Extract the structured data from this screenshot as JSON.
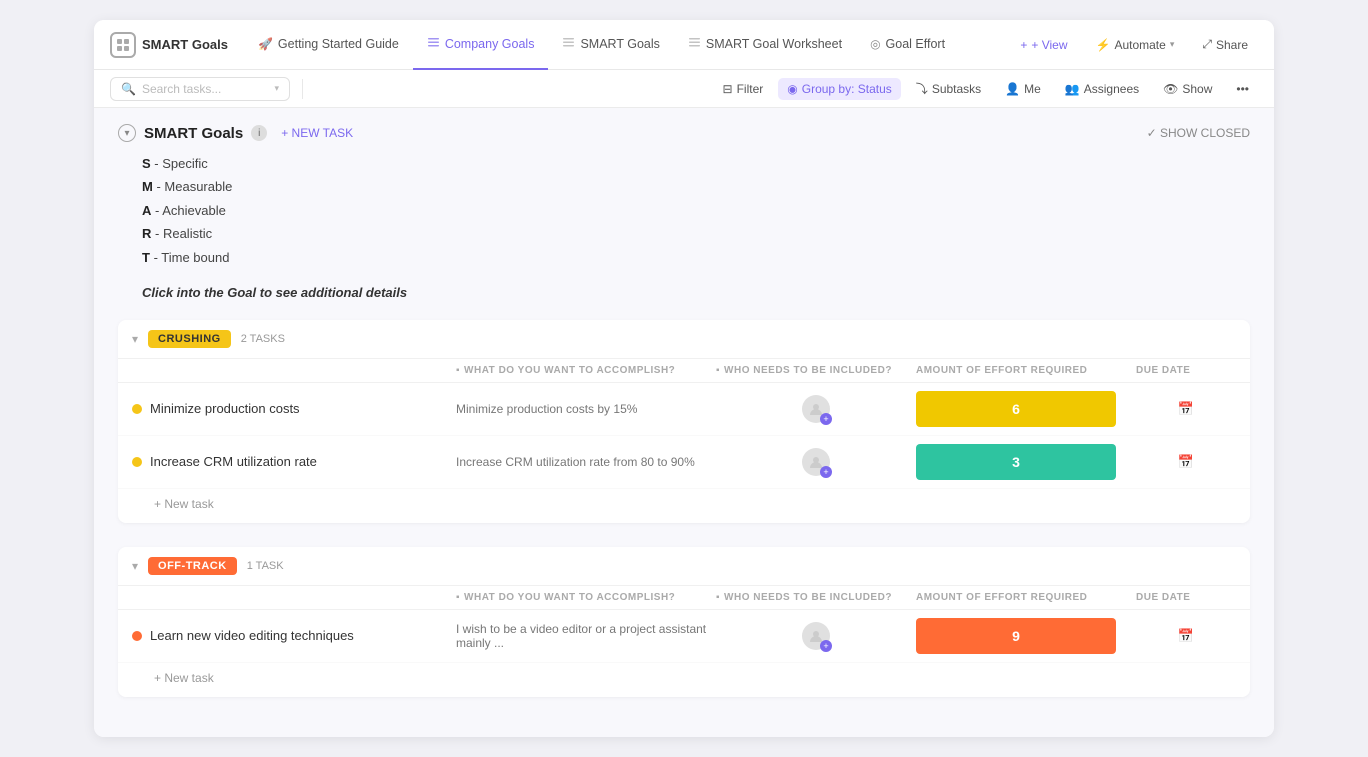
{
  "app": {
    "logo_label": "SMART Goals",
    "logo_icon": "⊞"
  },
  "tabs": [
    {
      "id": "getting-started",
      "label": "Getting Started Guide",
      "icon": "🚀",
      "active": false
    },
    {
      "id": "company-goals",
      "label": "Company Goals",
      "icon": "≡",
      "active": true
    },
    {
      "id": "smart-goals",
      "label": "SMART Goals",
      "icon": "≡",
      "active": false
    },
    {
      "id": "smart-worksheet",
      "label": "SMART Goal Worksheet",
      "icon": "≡",
      "active": false
    },
    {
      "id": "goal-effort",
      "label": "Goal Effort",
      "icon": "◎",
      "active": false
    }
  ],
  "toolbar_right": [
    {
      "id": "view",
      "label": "+ View",
      "icon": "+"
    },
    {
      "id": "automate",
      "label": "Automate",
      "icon": "⚡"
    },
    {
      "id": "share",
      "label": "Share",
      "icon": "⤢"
    }
  ],
  "search": {
    "placeholder": "Search tasks..."
  },
  "tools": [
    {
      "id": "filter",
      "label": "Filter",
      "icon": "⊟",
      "active": false
    },
    {
      "id": "group-by",
      "label": "Group by: Status",
      "icon": "◉",
      "active": true
    },
    {
      "id": "subtasks",
      "label": "Subtasks",
      "icon": "⤵",
      "active": false
    },
    {
      "id": "me",
      "label": "Me",
      "icon": "👤",
      "active": false
    },
    {
      "id": "assignees",
      "label": "Assignees",
      "icon": "👥",
      "active": false
    },
    {
      "id": "show",
      "label": "Show",
      "icon": "👁",
      "active": false
    }
  ],
  "section": {
    "title": "SMART Goals",
    "new_task_label": "+ NEW TASK",
    "show_closed_label": "✓ SHOW CLOSED",
    "smart_items": [
      {
        "letter": "S",
        "text": "- Specific"
      },
      {
        "letter": "M",
        "text": "- Measurable"
      },
      {
        "letter": "A",
        "text": "- Achievable"
      },
      {
        "letter": "R",
        "text": "- Realistic"
      },
      {
        "letter": "T",
        "text": "- Time bound"
      }
    ],
    "click_hint": "Click into the Goal to see additional details"
  },
  "columns": {
    "accomplish": "What do you want to accomplish?",
    "include": "Who needs to be included?",
    "effort": "Amount of effort required",
    "due_date": "Due Date"
  },
  "groups": [
    {
      "id": "crushing",
      "status": "CRUSHING",
      "status_class": "status-crushing",
      "task_count": "2 TASKS",
      "tasks": [
        {
          "id": "task-1",
          "name": "Minimize production costs",
          "accomplish": "Minimize production costs by 15%",
          "effort_value": "6",
          "effort_class": "effort-yellow",
          "dot_class": "task-dot-yellow"
        },
        {
          "id": "task-2",
          "name": "Increase CRM utilization rate",
          "accomplish": "Increase CRM utilization rate from 80 to 90%",
          "effort_value": "3",
          "effort_class": "effort-teal",
          "dot_class": "task-dot-yellow"
        }
      ],
      "new_task_label": "+ New task"
    },
    {
      "id": "off-track",
      "status": "OFF-TRACK",
      "status_class": "status-offtrack",
      "task_count": "1 TASK",
      "tasks": [
        {
          "id": "task-3",
          "name": "Learn new video editing techniques",
          "accomplish": "I wish to be a video editor or a project assistant mainly ...",
          "effort_value": "9",
          "effort_class": "effort-orange",
          "dot_class": "task-dot-orange"
        }
      ],
      "new_task_label": "+ New task"
    }
  ]
}
